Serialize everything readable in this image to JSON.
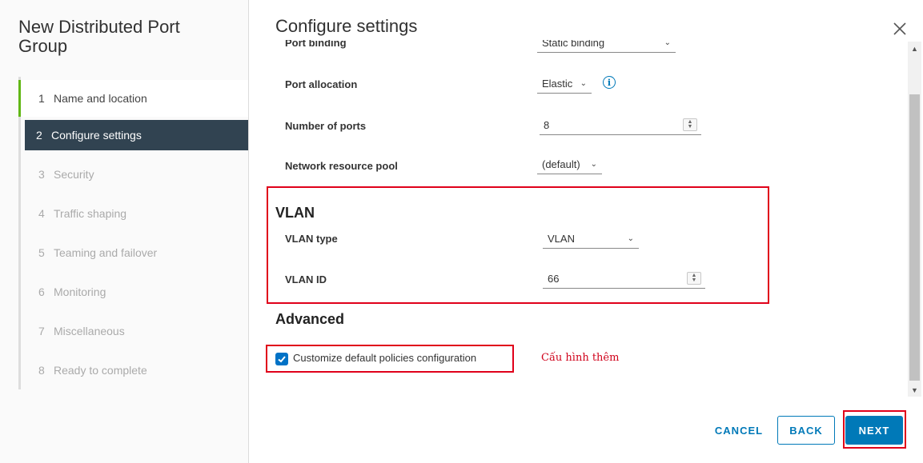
{
  "wizard": {
    "title": "New Distributed Port Group",
    "steps": [
      {
        "num": "1",
        "label": "Name and location"
      },
      {
        "num": "2",
        "label": "Configure settings"
      },
      {
        "num": "3",
        "label": "Security"
      },
      {
        "num": "4",
        "label": "Traffic shaping"
      },
      {
        "num": "5",
        "label": "Teaming and failover"
      },
      {
        "num": "6",
        "label": "Monitoring"
      },
      {
        "num": "7",
        "label": "Miscellaneous"
      },
      {
        "num": "8",
        "label": "Ready to complete"
      }
    ]
  },
  "main": {
    "title": "Configure settings",
    "port_binding": {
      "label": "Port binding",
      "value": "Static binding"
    },
    "port_allocation": {
      "label": "Port allocation",
      "value": "Elastic"
    },
    "number_of_ports": {
      "label": "Number of ports",
      "value": "8"
    },
    "network_resource_pool": {
      "label": "Network resource pool",
      "value": "(default)"
    },
    "vlan_section": {
      "heading": "VLAN",
      "vlan_type": {
        "label": "VLAN type",
        "value": "VLAN"
      },
      "vlan_id": {
        "label": "VLAN ID",
        "value": "66"
      }
    },
    "advanced_section": {
      "heading": "Advanced",
      "customize_label": "Customize default policies configuration",
      "customize_checked": true
    },
    "annotation_note": "Cấu hình thêm"
  },
  "footer": {
    "cancel": "CANCEL",
    "back": "BACK",
    "next": "NEXT"
  },
  "colors": {
    "accent": "#0079b8",
    "active_step_bg": "#314351",
    "done_step_bar": "#61b715",
    "highlight_red": "#e0001a"
  }
}
